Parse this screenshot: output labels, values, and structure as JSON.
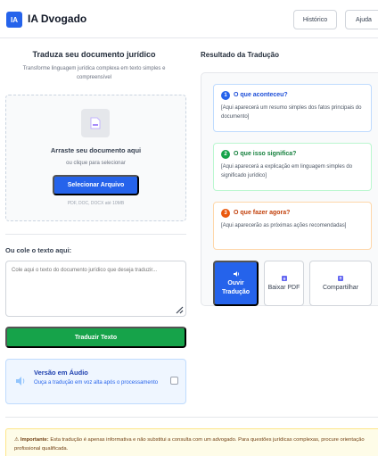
{
  "header": {
    "logo": "IA",
    "title": "IA Dvogado",
    "history_label": "Histórico",
    "help_label": "Ajuda"
  },
  "upload": {
    "title": "Traduza seu documento jurídico",
    "subtitle": "Transforme linguagem jurídica complexa em texto simples e compreensível",
    "drop_title": "Arraste seu documento aqui",
    "drop_sub": "ou clique para selecionar",
    "select_button": "Selecionar Arquivo",
    "formats": "PDF, DOC, DOCX até 10MB"
  },
  "paste": {
    "label": "Ou cole o texto aqui:",
    "placeholder": "Cole aqui o texto do documento jurídico que deseja traduzir...",
    "value": ""
  },
  "translate_button": "Traduzir Texto",
  "audio": {
    "title": "Versão em Áudio",
    "description": "Ouça a tradução em voz alta após o processamento",
    "checked": false
  },
  "result": {
    "title": "Resultado da Tradução",
    "cards": [
      {
        "number": "1",
        "title": "O que aconteceu?",
        "body": "[Aqui aparecerá um resumo simples dos fatos principais do documento]"
      },
      {
        "number": "2",
        "title": "O que isso significa?",
        "body": "[Aqui aparecerá a explicação em linguagem simples do significado jurídico]"
      },
      {
        "number": "3",
        "title": "O que fazer agora?",
        "body": "[Aqui aparecerão as próximas ações recomendadas]"
      }
    ],
    "actions": {
      "listen": "Ouvir Tradução",
      "pdf": "Baixar PDF",
      "share": "Compartilhar"
    }
  },
  "notice": {
    "strong": "Importante:",
    "text": "Esta tradução é apenas informativa e não substitui a consulta com um advogado. Para questões jurídicas complexas, procure orientação profissional qualificada."
  },
  "colors": {
    "primary": "#2563eb",
    "success": "#16a34a",
    "warning": "#ea580c"
  }
}
